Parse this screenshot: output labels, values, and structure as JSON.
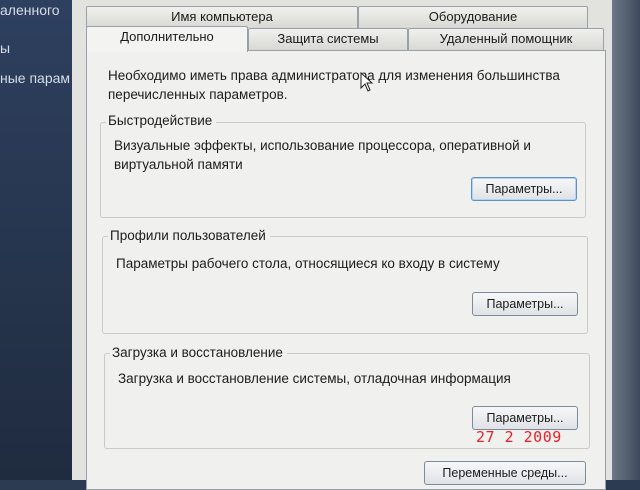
{
  "background_window": {
    "text_1": "аленного",
    "text_2": "ы",
    "text_3": "ные парам"
  },
  "tabs": {
    "row_back": [
      {
        "label": "Имя компьютера"
      },
      {
        "label": "Оборудование"
      }
    ],
    "row_front": [
      {
        "label": "Дополнительно"
      },
      {
        "label": "Защита системы"
      },
      {
        "label": "Удаленный помощник"
      }
    ]
  },
  "admin_note": "Необходимо иметь права администратора для изменения большинства перечисленных параметров.",
  "groups": [
    {
      "title": "Быстродействие",
      "description": "Визуальные эффекты, использование процессора, оперативной и виртуальной памяти",
      "button": "Параметры..."
    },
    {
      "title": "Профили пользователей",
      "description": "Параметры рабочего стола, относящиеся ко входу в систему",
      "button": "Параметры..."
    },
    {
      "title": "Загрузка и восстановление",
      "description": "Загрузка и восстановление системы, отладочная информация",
      "button": "Параметры..."
    }
  ],
  "env_button": "Переменные среды...",
  "camera_timestamp": "27  2 2009",
  "colors": {
    "timestamp": "#e8202a",
    "focus_border": "#5d8fc9"
  }
}
